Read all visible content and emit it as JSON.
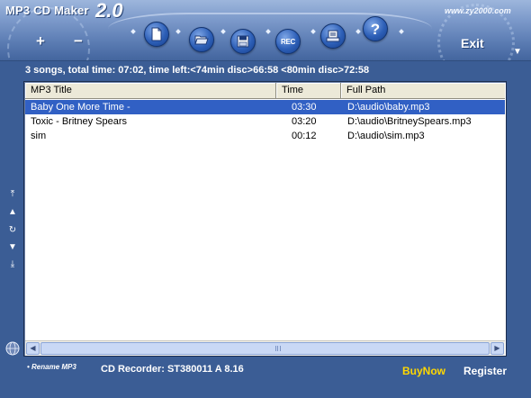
{
  "app": {
    "name": "MP3 CD Maker",
    "version": "2.0",
    "url": "www.zy2000.com"
  },
  "header": {
    "plus_label": "+",
    "minus_label": "−",
    "exit_label": "Exit",
    "menu_arrow": "▼",
    "toolbar": [
      {
        "name": "new-file",
        "icon": "document-icon"
      },
      {
        "name": "open-folder",
        "icon": "folder-open-icon"
      },
      {
        "name": "save",
        "icon": "floppy-disk-icon"
      },
      {
        "name": "record",
        "icon": "rec-icon",
        "label": "REC"
      },
      {
        "name": "burner",
        "icon": "cd-burner-icon"
      },
      {
        "name": "help",
        "icon": "help-icon",
        "label": "?"
      }
    ]
  },
  "status": "3 songs, total time: 07:02, time left:<74min disc>66:58 <80min disc>72:58",
  "table": {
    "columns": [
      "MP3 Title",
      "Time",
      "Full Path"
    ],
    "rows": [
      {
        "title": "Baby One More Time -",
        "time": "03:30",
        "path": "D:\\audio\\baby.mp3",
        "selected": true
      },
      {
        "title": "Toxic - Britney Spears",
        "time": "03:20",
        "path": "D:\\audio\\BritneySpears.mp3",
        "selected": false
      },
      {
        "title": "sim",
        "time": "00:12",
        "path": "D:\\audio\\sim.mp3",
        "selected": false
      }
    ]
  },
  "side_controls": {
    "move_top": "⤒",
    "move_up": "▲",
    "shuffle": "↻",
    "move_down": "▼",
    "move_bottom": "⤓"
  },
  "footer": {
    "rename_label": "• Rename MP3",
    "recorder": "CD Recorder: ST380011 A 8.16",
    "buynow_label": "BuyNow",
    "register_label": "Register"
  },
  "colors": {
    "window_bg": "#3b5d95",
    "selection": "#3160c4",
    "buynow": "#ffd700",
    "header_top": "#9db6dc"
  }
}
